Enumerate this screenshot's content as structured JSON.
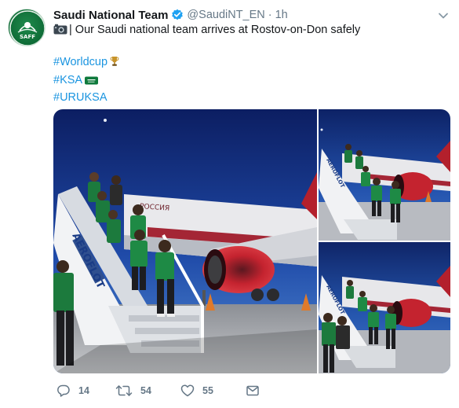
{
  "author": {
    "name": "Saudi National Team",
    "handle": "@SaudiNT_EN",
    "time": "1h",
    "avatar_label": "SAFF",
    "verified": true
  },
  "tweet": {
    "text": "| Our Saudi national team arrives at Rostov-on-Don safely",
    "hashtags": [
      "#Worldcup",
      "#KSA",
      "#URUKSA"
    ]
  },
  "media": {
    "photos": [
      {
        "label": "team descending aircraft stairs",
        "jetbridge_text": "AEROFLOT",
        "fuselage_text": "РОССИЯ"
      },
      {
        "label": "team on stairs, top view",
        "jetbridge_text": "AEROFLOT"
      },
      {
        "label": "team on stairs, bottom view",
        "jetbridge_text": "AEROFLOT"
      }
    ]
  },
  "actions": {
    "replies": "14",
    "retweets": "54",
    "likes": "55"
  },
  "icons": {
    "verified": "verified-badge-icon",
    "camera": "camera-icon",
    "trophy": "trophy-icon",
    "flag": "saudi-flag-icon",
    "reply": "reply-icon",
    "retweet": "retweet-icon",
    "like": "heart-icon",
    "dm": "envelope-icon",
    "more": "chevron-down-icon"
  },
  "colors": {
    "link": "#1b95e0",
    "verified": "#1da1f2",
    "muted": "#657786",
    "text": "#14171a"
  }
}
